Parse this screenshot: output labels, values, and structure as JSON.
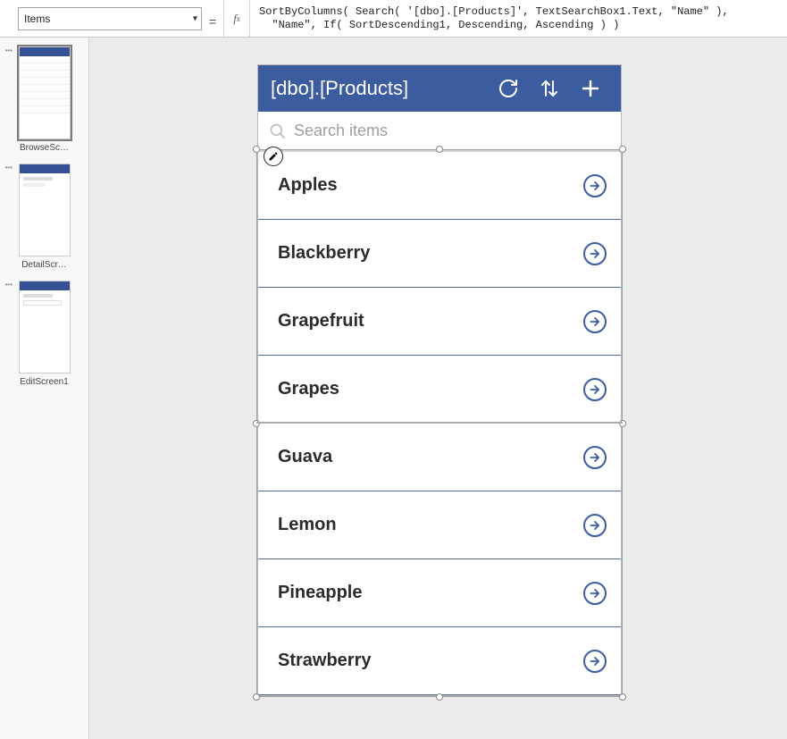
{
  "property_dropdown": "Items",
  "formula": "SortByColumns( Search( '[dbo].[Products]', TextSearchBox1.Text, \"Name\" ),\n  \"Name\", If( SortDescending1, Descending, Ascending ) )",
  "thumbs": [
    {
      "label": "BrowseSc…"
    },
    {
      "label": "DetailScr…"
    },
    {
      "label": "EditScreen1"
    }
  ],
  "app": {
    "title": "[dbo].[Products]",
    "search_placeholder": "Search items",
    "items": [
      "Apples",
      "Blackberry",
      "Grapefruit",
      "Grapes",
      "Guava",
      "Lemon",
      "Pineapple",
      "Strawberry"
    ]
  }
}
